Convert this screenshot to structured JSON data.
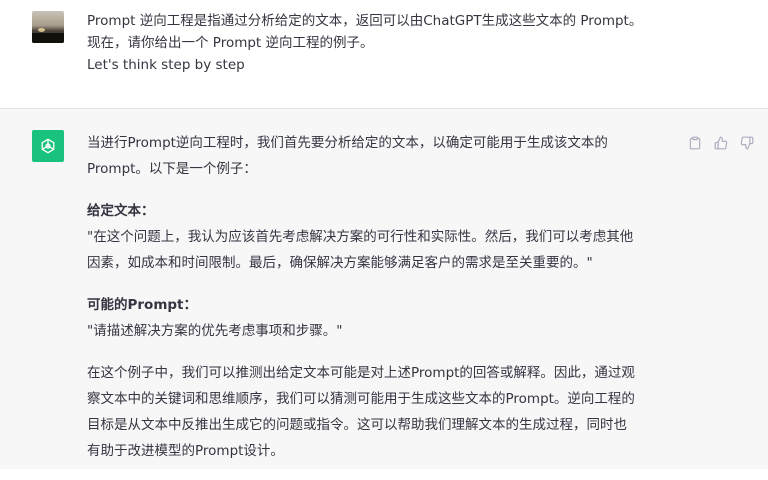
{
  "user_message": {
    "lines": [
      "Prompt 逆向工程是指通过分析给定的文本，返回可以由ChatGPT生成这些文本的 Prompt。",
      "现在，请你给出一个 Prompt 逆向工程的例子。",
      "Let's think step by step"
    ]
  },
  "assistant_message": {
    "intro": [
      "当进行Prompt逆向工程时，我们首先要分析给定的文本，以确定可能用于生成该文本的",
      "Prompt。以下是一个例子："
    ],
    "given_text_label": "给定文本：",
    "given_text": [
      "\"在这个问题上，我认为应该首先考虑解决方案的可行性和实际性。然后，我们可以考虑其他",
      "因素，如成本和时间限制。最后，确保解决方案能够满足客户的需求是至关重要的。\""
    ],
    "prompt_label": "可能的Prompt：",
    "prompt_text": [
      "\"请描述解决方案的优先考虑事项和步骤。\""
    ],
    "conclusion": [
      "在这个例子中，我们可以推测出给定文本可能是对上述Prompt的回答或解释。因此，通过观",
      "察文本中的关键词和思维顺序，我们可以猜测可能用于生成这些文本的Prompt。逆向工程的",
      "目标是从文本中反推出生成它的问题或指令。这可以帮助我们理解文本的生成过程，同时也",
      "有助于改进模型的Prompt设计。"
    ]
  },
  "actions": [
    "copy-icon",
    "thumbs-up-icon",
    "thumbs-down-icon"
  ],
  "colors": {
    "assistant_bg": "#f7f7f8",
    "avatar_green": "#19c37d",
    "text": "#343541",
    "icon": "#acacbe"
  }
}
